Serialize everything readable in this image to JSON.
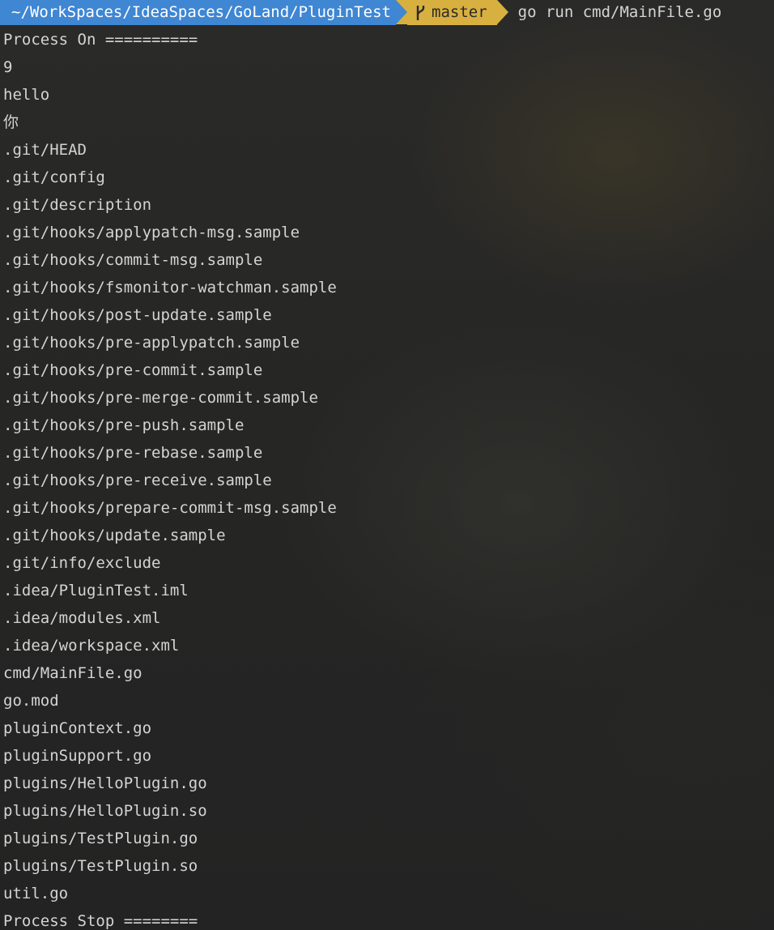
{
  "prompt": {
    "path": "~/WorkSpaces/IdeaSpaces/GoLand/PluginTest",
    "branch": "master",
    "branch_icon": "git-branch-icon",
    "command": "go run cmd/MainFile.go"
  },
  "output": {
    "lines": [
      "Process On ==========",
      "9",
      "hello",
      "你",
      ".git/HEAD",
      ".git/config",
      ".git/description",
      ".git/hooks/applypatch-msg.sample",
      ".git/hooks/commit-msg.sample",
      ".git/hooks/fsmonitor-watchman.sample",
      ".git/hooks/post-update.sample",
      ".git/hooks/pre-applypatch.sample",
      ".git/hooks/pre-commit.sample",
      ".git/hooks/pre-merge-commit.sample",
      ".git/hooks/pre-push.sample",
      ".git/hooks/pre-rebase.sample",
      ".git/hooks/pre-receive.sample",
      ".git/hooks/prepare-commit-msg.sample",
      ".git/hooks/update.sample",
      ".git/info/exclude",
      ".idea/PluginTest.iml",
      ".idea/modules.xml",
      ".idea/workspace.xml",
      "cmd/MainFile.go",
      "go.mod",
      "pluginContext.go",
      "pluginSupport.go",
      "plugins/HelloPlugin.go",
      "plugins/HelloPlugin.so",
      "plugins/TestPlugin.go",
      "plugins/TestPlugin.so",
      "util.go",
      "Process Stop ========"
    ]
  },
  "colors": {
    "path_segment": "#3f86d3",
    "git_segment": "#d8b040",
    "text": "#d4d4d4",
    "background": "#262626"
  }
}
